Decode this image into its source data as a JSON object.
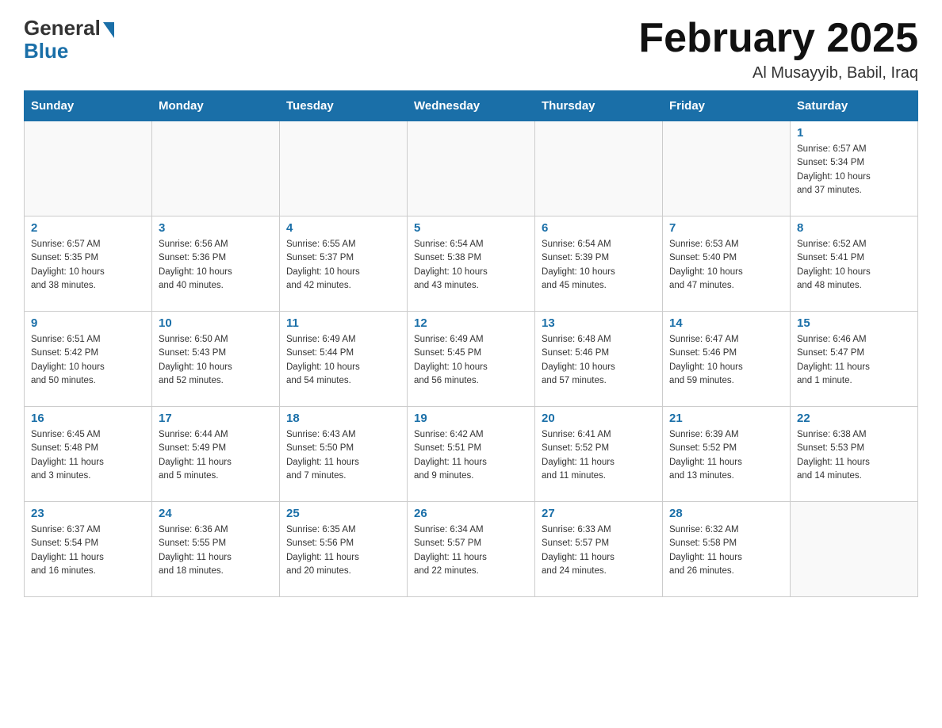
{
  "header": {
    "logo_general": "General",
    "logo_blue": "Blue",
    "month_title": "February 2025",
    "location": "Al Musayyib, Babil, Iraq"
  },
  "days_of_week": [
    "Sunday",
    "Monday",
    "Tuesday",
    "Wednesday",
    "Thursday",
    "Friday",
    "Saturday"
  ],
  "weeks": [
    [
      {
        "day": "",
        "info": ""
      },
      {
        "day": "",
        "info": ""
      },
      {
        "day": "",
        "info": ""
      },
      {
        "day": "",
        "info": ""
      },
      {
        "day": "",
        "info": ""
      },
      {
        "day": "",
        "info": ""
      },
      {
        "day": "1",
        "info": "Sunrise: 6:57 AM\nSunset: 5:34 PM\nDaylight: 10 hours\nand 37 minutes."
      }
    ],
    [
      {
        "day": "2",
        "info": "Sunrise: 6:57 AM\nSunset: 5:35 PM\nDaylight: 10 hours\nand 38 minutes."
      },
      {
        "day": "3",
        "info": "Sunrise: 6:56 AM\nSunset: 5:36 PM\nDaylight: 10 hours\nand 40 minutes."
      },
      {
        "day": "4",
        "info": "Sunrise: 6:55 AM\nSunset: 5:37 PM\nDaylight: 10 hours\nand 42 minutes."
      },
      {
        "day": "5",
        "info": "Sunrise: 6:54 AM\nSunset: 5:38 PM\nDaylight: 10 hours\nand 43 minutes."
      },
      {
        "day": "6",
        "info": "Sunrise: 6:54 AM\nSunset: 5:39 PM\nDaylight: 10 hours\nand 45 minutes."
      },
      {
        "day": "7",
        "info": "Sunrise: 6:53 AM\nSunset: 5:40 PM\nDaylight: 10 hours\nand 47 minutes."
      },
      {
        "day": "8",
        "info": "Sunrise: 6:52 AM\nSunset: 5:41 PM\nDaylight: 10 hours\nand 48 minutes."
      }
    ],
    [
      {
        "day": "9",
        "info": "Sunrise: 6:51 AM\nSunset: 5:42 PM\nDaylight: 10 hours\nand 50 minutes."
      },
      {
        "day": "10",
        "info": "Sunrise: 6:50 AM\nSunset: 5:43 PM\nDaylight: 10 hours\nand 52 minutes."
      },
      {
        "day": "11",
        "info": "Sunrise: 6:49 AM\nSunset: 5:44 PM\nDaylight: 10 hours\nand 54 minutes."
      },
      {
        "day": "12",
        "info": "Sunrise: 6:49 AM\nSunset: 5:45 PM\nDaylight: 10 hours\nand 56 minutes."
      },
      {
        "day": "13",
        "info": "Sunrise: 6:48 AM\nSunset: 5:46 PM\nDaylight: 10 hours\nand 57 minutes."
      },
      {
        "day": "14",
        "info": "Sunrise: 6:47 AM\nSunset: 5:46 PM\nDaylight: 10 hours\nand 59 minutes."
      },
      {
        "day": "15",
        "info": "Sunrise: 6:46 AM\nSunset: 5:47 PM\nDaylight: 11 hours\nand 1 minute."
      }
    ],
    [
      {
        "day": "16",
        "info": "Sunrise: 6:45 AM\nSunset: 5:48 PM\nDaylight: 11 hours\nand 3 minutes."
      },
      {
        "day": "17",
        "info": "Sunrise: 6:44 AM\nSunset: 5:49 PM\nDaylight: 11 hours\nand 5 minutes."
      },
      {
        "day": "18",
        "info": "Sunrise: 6:43 AM\nSunset: 5:50 PM\nDaylight: 11 hours\nand 7 minutes."
      },
      {
        "day": "19",
        "info": "Sunrise: 6:42 AM\nSunset: 5:51 PM\nDaylight: 11 hours\nand 9 minutes."
      },
      {
        "day": "20",
        "info": "Sunrise: 6:41 AM\nSunset: 5:52 PM\nDaylight: 11 hours\nand 11 minutes."
      },
      {
        "day": "21",
        "info": "Sunrise: 6:39 AM\nSunset: 5:52 PM\nDaylight: 11 hours\nand 13 minutes."
      },
      {
        "day": "22",
        "info": "Sunrise: 6:38 AM\nSunset: 5:53 PM\nDaylight: 11 hours\nand 14 minutes."
      }
    ],
    [
      {
        "day": "23",
        "info": "Sunrise: 6:37 AM\nSunset: 5:54 PM\nDaylight: 11 hours\nand 16 minutes."
      },
      {
        "day": "24",
        "info": "Sunrise: 6:36 AM\nSunset: 5:55 PM\nDaylight: 11 hours\nand 18 minutes."
      },
      {
        "day": "25",
        "info": "Sunrise: 6:35 AM\nSunset: 5:56 PM\nDaylight: 11 hours\nand 20 minutes."
      },
      {
        "day": "26",
        "info": "Sunrise: 6:34 AM\nSunset: 5:57 PM\nDaylight: 11 hours\nand 22 minutes."
      },
      {
        "day": "27",
        "info": "Sunrise: 6:33 AM\nSunset: 5:57 PM\nDaylight: 11 hours\nand 24 minutes."
      },
      {
        "day": "28",
        "info": "Sunrise: 6:32 AM\nSunset: 5:58 PM\nDaylight: 11 hours\nand 26 minutes."
      },
      {
        "day": "",
        "info": ""
      }
    ]
  ]
}
